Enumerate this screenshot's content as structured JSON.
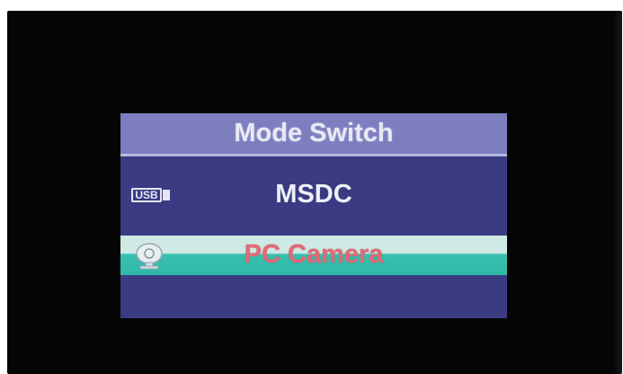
{
  "menu": {
    "title": "Mode Switch",
    "items": [
      {
        "label": "MSDC",
        "icon": "usb-icon",
        "icon_text": "USB",
        "selected": false
      },
      {
        "label": "PC Camera",
        "icon": "webcam-icon",
        "selected": true
      }
    ]
  },
  "colors": {
    "title_bar": "#7c7ec0",
    "panel": "#3a3b82",
    "highlight": "#38bfae",
    "selected_text": "#e06a78"
  }
}
